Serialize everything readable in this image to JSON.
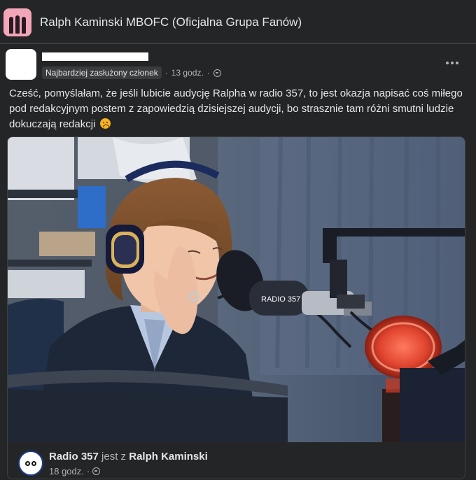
{
  "group": {
    "name": "Ralph Kaminski MBOFC (Oficjalna Grupa Fanów)"
  },
  "post": {
    "badge": "Najbardziej zasłużony członek",
    "separator": "·",
    "time": "13 godz.",
    "text": "Cześć, pomyślałam, że jeśli lubicie audycję Ralpha w radio 357, to jest okazja napisać coś miłego pod redakcyjnym postem z zapowiedzią dzisiejszej audycji, bo strasznie tam różni smutni ludzie dokuczają redakcji",
    "emoji_icon": "sad-face-emoji-icon"
  },
  "shared": {
    "page_name": "Radio 357",
    "with_text": "jest z",
    "tagged_name": "Ralph Kaminski",
    "time": "18 godz.",
    "mic_logo_text": "RADIO 357"
  },
  "colors": {
    "background": "#18191a",
    "card": "#242526",
    "text_primary": "#e4e6eb",
    "text_secondary": "#b0b3b8"
  }
}
